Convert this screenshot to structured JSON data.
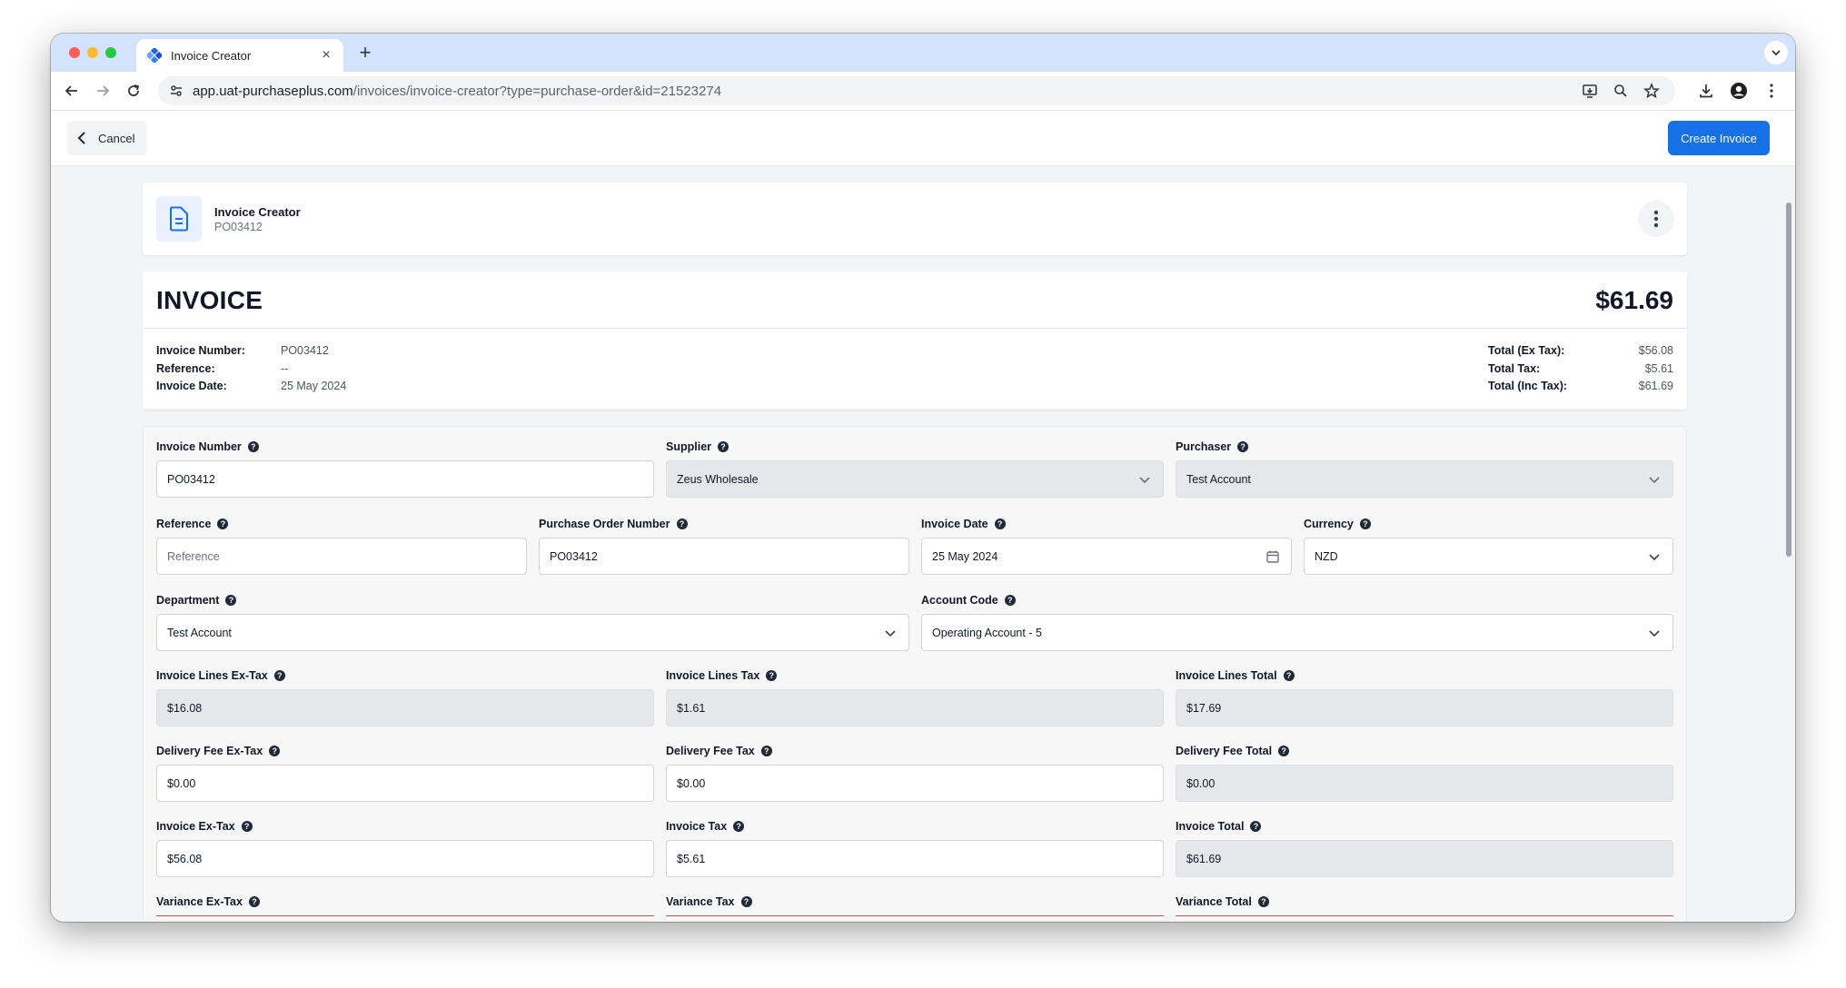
{
  "browser": {
    "tab_title": "Invoice Creator",
    "tab_close": "×",
    "new_tab": "+",
    "url_host": "app.uat-purchaseplus.com",
    "url_path": "/invoices/invoice-creator?type=purchase-order&id=21523274"
  },
  "header": {
    "cancel_label": "Cancel",
    "create_label": "Create Invoice"
  },
  "page": {
    "title": "Invoice Creator",
    "subtitle": "PO03412"
  },
  "summary": {
    "heading": "INVOICE",
    "amount": "$61.69",
    "left": [
      {
        "label": "Invoice Number:",
        "value": "PO03412"
      },
      {
        "label": "Reference:",
        "value": "--"
      },
      {
        "label": "Invoice Date:",
        "value": "25 May 2024"
      }
    ],
    "right": [
      {
        "label": "Total (Ex Tax):",
        "value": "$56.08"
      },
      {
        "label": "Total Tax:",
        "value": "$5.61"
      },
      {
        "label": "Total (Inc Tax):",
        "value": "$61.69"
      }
    ]
  },
  "form": {
    "invoice_number": {
      "label": "Invoice Number",
      "value": "PO03412"
    },
    "supplier": {
      "label": "Supplier",
      "value": "Zeus Wholesale"
    },
    "purchaser": {
      "label": "Purchaser",
      "value": "Test Account"
    },
    "reference": {
      "label": "Reference",
      "placeholder": "Reference"
    },
    "po_number": {
      "label": "Purchase Order Number",
      "value": "PO03412"
    },
    "invoice_date": {
      "label": "Invoice Date",
      "value": "25 May 2024"
    },
    "currency": {
      "label": "Currency",
      "value": "NZD"
    },
    "department": {
      "label": "Department",
      "value": "Test Account"
    },
    "account_code": {
      "label": "Account Code",
      "value": "Operating Account - 5"
    },
    "lines_ex_tax": {
      "label": "Invoice Lines Ex-Tax",
      "value": "$16.08"
    },
    "lines_tax": {
      "label": "Invoice Lines Tax",
      "value": "$1.61"
    },
    "lines_total": {
      "label": "Invoice Lines Total",
      "value": "$17.69"
    },
    "delivery_ex_tax": {
      "label": "Delivery Fee Ex-Tax",
      "value": "$0.00"
    },
    "delivery_tax": {
      "label": "Delivery Fee Tax",
      "value": "$0.00"
    },
    "delivery_total": {
      "label": "Delivery Fee Total",
      "value": "$0.00"
    },
    "invoice_ex_tax": {
      "label": "Invoice Ex-Tax",
      "value": "$56.08"
    },
    "invoice_tax": {
      "label": "Invoice Tax",
      "value": "$5.61"
    },
    "invoice_total": {
      "label": "Invoice Total",
      "value": "$61.69"
    },
    "variance_ex_tax": {
      "label": "Variance Ex-Tax"
    },
    "variance_tax": {
      "label": "Variance Tax"
    },
    "variance_total": {
      "label": "Variance Total"
    }
  },
  "colors": {
    "accent": "#1670e6",
    "error": "#ef4444"
  }
}
